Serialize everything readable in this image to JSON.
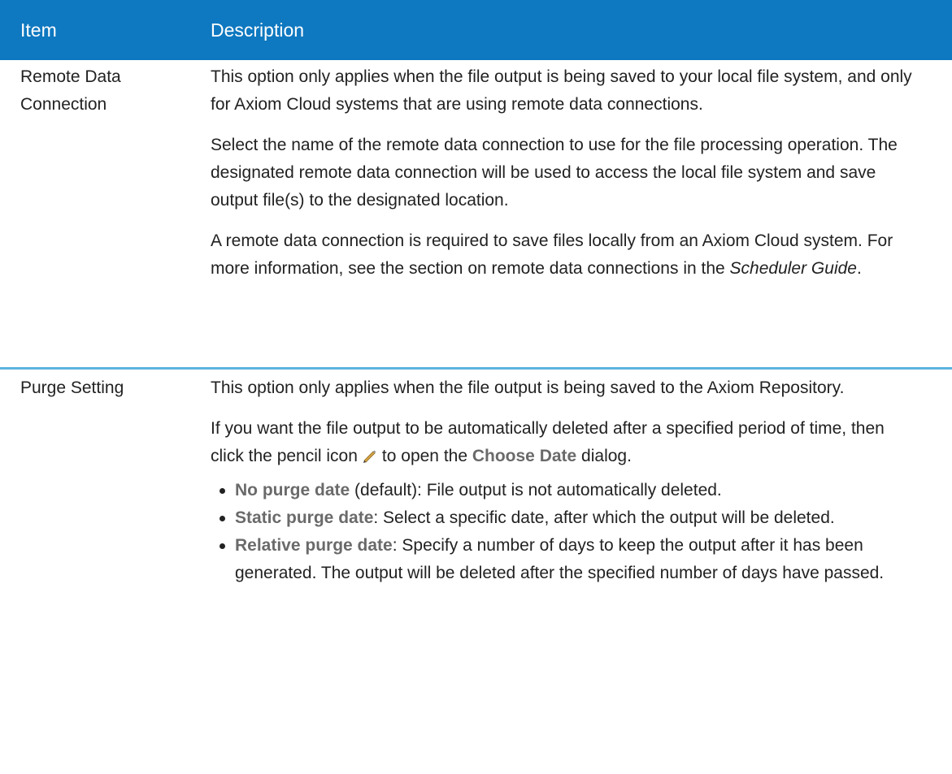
{
  "table": {
    "header": {
      "item": "Item",
      "description": "Description"
    },
    "rows": [
      {
        "item": "Remote Data Connection",
        "paragraphs": [
          "This option only applies when the file output is being saved to your local file system, and only for Axiom Cloud systems that are using remote data connections.",
          "Select the name of the remote data connection to use for the file processing operation. The designated remote data connection will be used to access the local file system and save output file(s) to the designated location.",
          {
            "before": "A remote data connection is required to save files locally from an Axiom Cloud system. For more information, see the section on remote data connections in the ",
            "emphasis": "Scheduler Guide",
            "after": "."
          }
        ]
      },
      {
        "item": "Purge Setting",
        "paragraphs": [
          "This option only applies when the file output is being saved to the Axiom Repository.",
          {
            "before": "If you want the file output to be automatically deleted after a specified period of time, then click the pencil icon",
            "icon": "pencil-icon",
            "middle": "to open the ",
            "label": "Choose Date",
            "after": " dialog."
          }
        ],
        "bullets": [
          {
            "label": "No purge date",
            "text": " (default): File output is not automatically deleted."
          },
          {
            "label": "Static purge date",
            "text": ": Select a specific date, after which the output will be deleted."
          },
          {
            "label": "Relative purge date",
            "text": ": Specify a number of days to keep the output after it has been generated. The output will be deleted after the specified number of days have passed."
          }
        ]
      }
    ]
  },
  "colors": {
    "header_bg": "#0e78c0",
    "row_divider": "#5ab4e0",
    "ui_label": "#6a6a6a"
  }
}
